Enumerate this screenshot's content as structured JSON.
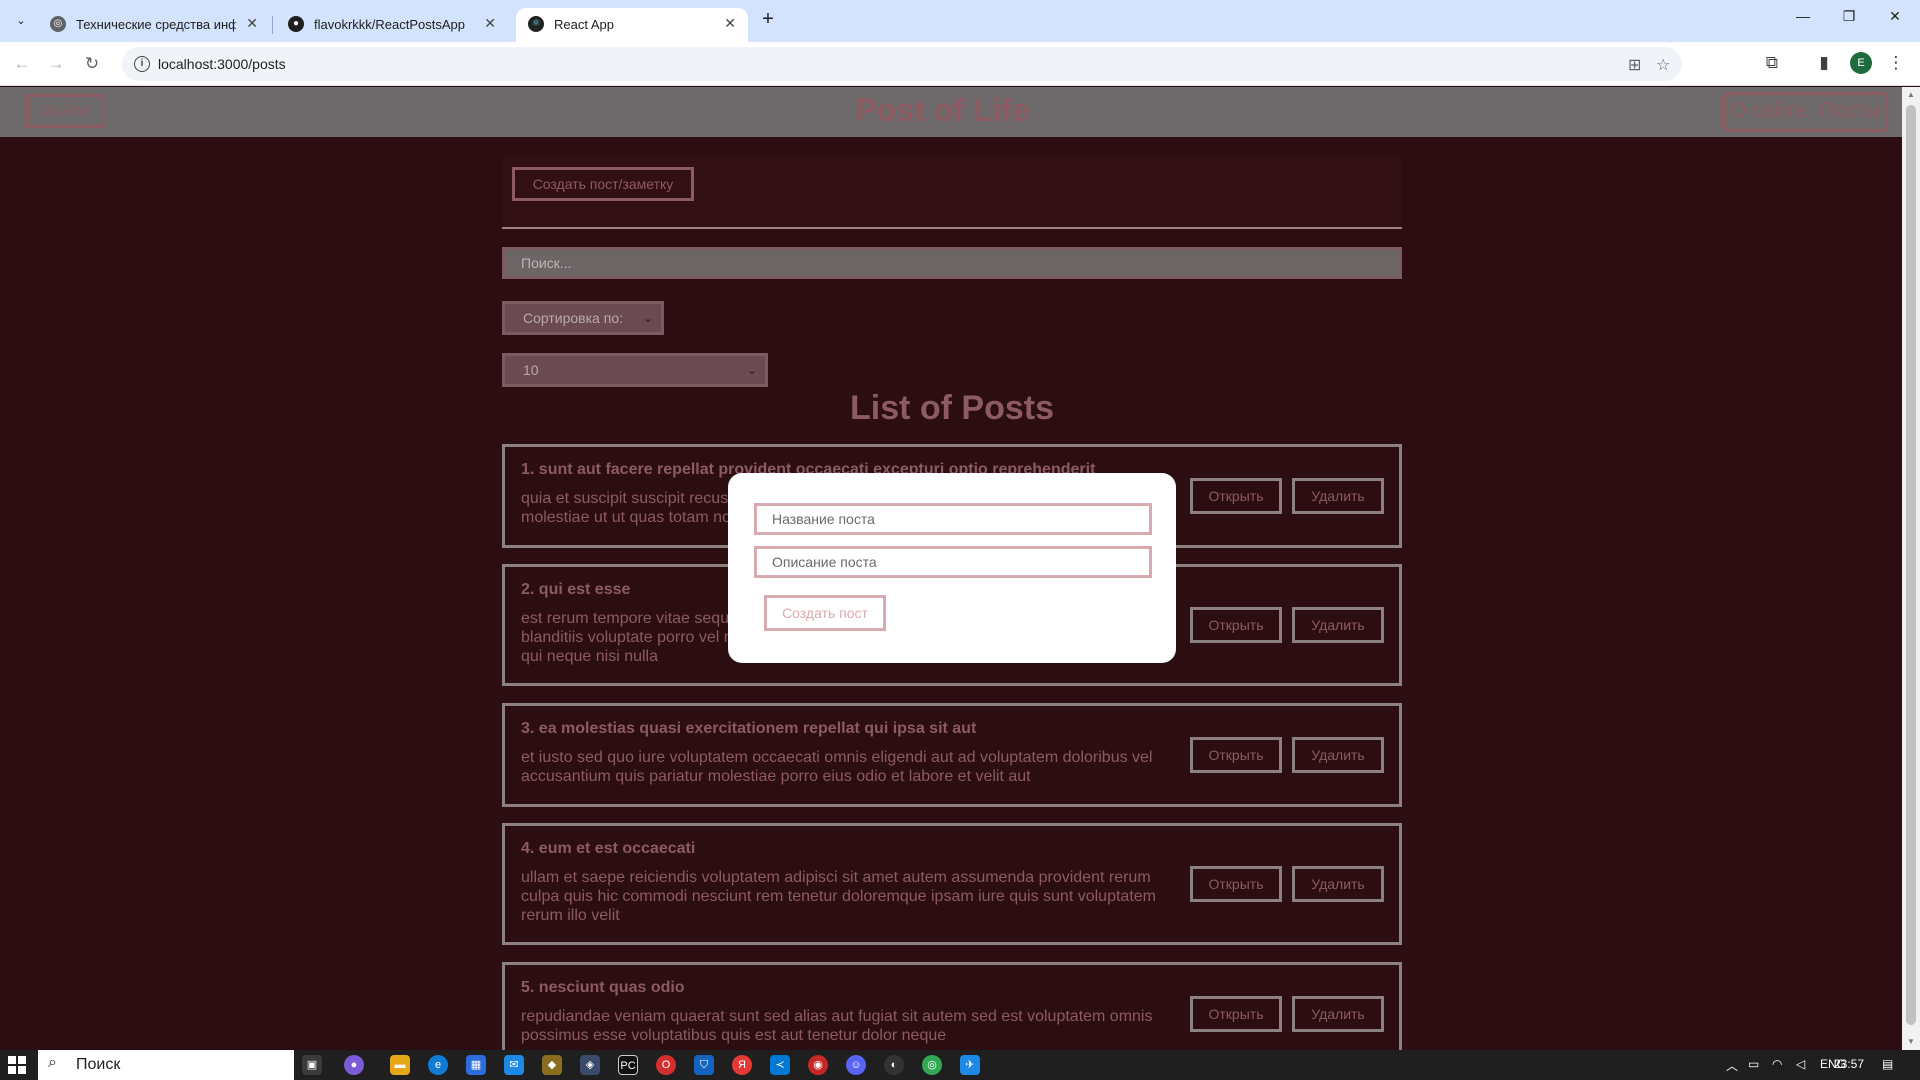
{
  "browser": {
    "tabs": [
      {
        "title": "Технические средства инфор",
        "active": false,
        "favicon": "globe"
      },
      {
        "title": "flavokrkkk/ReactPostsApp",
        "active": false,
        "favicon": "github"
      },
      {
        "title": "React App",
        "active": true,
        "favicon": "react"
      }
    ],
    "new_tab": "+",
    "window_controls": {
      "minimize": "—",
      "maximize": "❐",
      "close": "✕"
    },
    "url": "localhost:3000/posts",
    "profile_initial": "E"
  },
  "app": {
    "navbar": {
      "logout_label": "Выйти",
      "brand": "Post of Life",
      "links": [
        "О сайте",
        "Посты"
      ]
    },
    "create_button": "Создать пост/заметку",
    "search_placeholder": "Поиск...",
    "sort_select": "Сортировка по:",
    "limit_select": "10",
    "list_title": "List of Posts",
    "posts": [
      {
        "title": "1. sunt aut facere repellat provident occaecati excepturi optio reprehenderit",
        "body": "quia et suscipit suscipit recusandae consequuntur expedita et cum reprehenderit molestiae ut ut quas totam nostrum rerum est autem sunt rem eveniet architecto"
      },
      {
        "title": "2. qui est esse",
        "body": "est rerum tempore vitae sequi sint nihil reprehenderit dolor beatae ea dolores neque fugiat blanditiis voluptate porro vel nihil molestiae ut reiciendis qui aperiam non debitis possimus qui neque nisi nulla"
      },
      {
        "title": "3. ea molestias quasi exercitationem repellat qui ipsa sit aut",
        "body": "et iusto sed quo iure voluptatem occaecati omnis eligendi aut ad voluptatem doloribus vel accusantium quis pariatur molestiae porro eius odio et labore et velit aut"
      },
      {
        "title": "4. eum et est occaecati",
        "body": "ullam et saepe reiciendis voluptatem adipisci sit amet autem assumenda provident rerum culpa quis hic commodi nesciunt rem tenetur doloremque ipsam iure quis sunt voluptatem rerum illo velit"
      },
      {
        "title": "5. nesciunt quas odio",
        "body": "repudiandae veniam quaerat sunt sed alias aut fugiat sit autem sed est voluptatem omnis possimus esse voluptatibus quis est aut tenetur dolor neque"
      }
    ],
    "post_open_label": "Открыть",
    "post_delete_label": "Удалить",
    "modal": {
      "title_placeholder": "Название поста",
      "body_placeholder": "Описание поста",
      "submit_label": "Создать пост"
    }
  },
  "taskbar": {
    "search_label": "Поиск",
    "language": "ENG",
    "time": "23:57"
  },
  "colors": {
    "page_bg": "#2c0d11",
    "accent": "#8c5b61",
    "navbar_bg": "#6e6a6b",
    "modal_border": "#d8a9ae"
  }
}
